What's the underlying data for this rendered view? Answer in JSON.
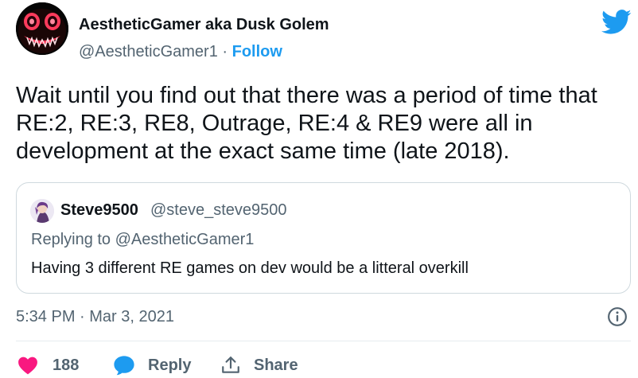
{
  "author": {
    "display_name": "AestheticGamer aka Dusk Golem",
    "handle": "@AestheticGamer1",
    "separator": "·",
    "follow_label": "Follow",
    "avatar_icon": "demon-face-avatar"
  },
  "logo_icon": "twitter-bird-icon",
  "tweet": {
    "lines": [
      "Wait until you find out that there was a period of time that",
      "RE:2, RE:3, RE8, Outrage, RE:4 & RE9 were all in",
      "development at the exact same time (late 2018)."
    ]
  },
  "quote": {
    "author_name": "Steve9500",
    "author_handle": "@steve_steve9500",
    "replying_to": "Replying to @AestheticGamer1",
    "text": "Having 3 different RE games on dev would be a litteral overkill"
  },
  "meta": {
    "timestamp": "5:34 PM · Mar 3, 2021"
  },
  "actions": {
    "like_count": "188",
    "reply_label": "Reply",
    "share_label": "Share"
  },
  "colors": {
    "accent": "#1d9bf0",
    "like": "#f91880",
    "text_primary": "#0f1419",
    "text_secondary": "#536471",
    "border": "#cfd9de"
  }
}
